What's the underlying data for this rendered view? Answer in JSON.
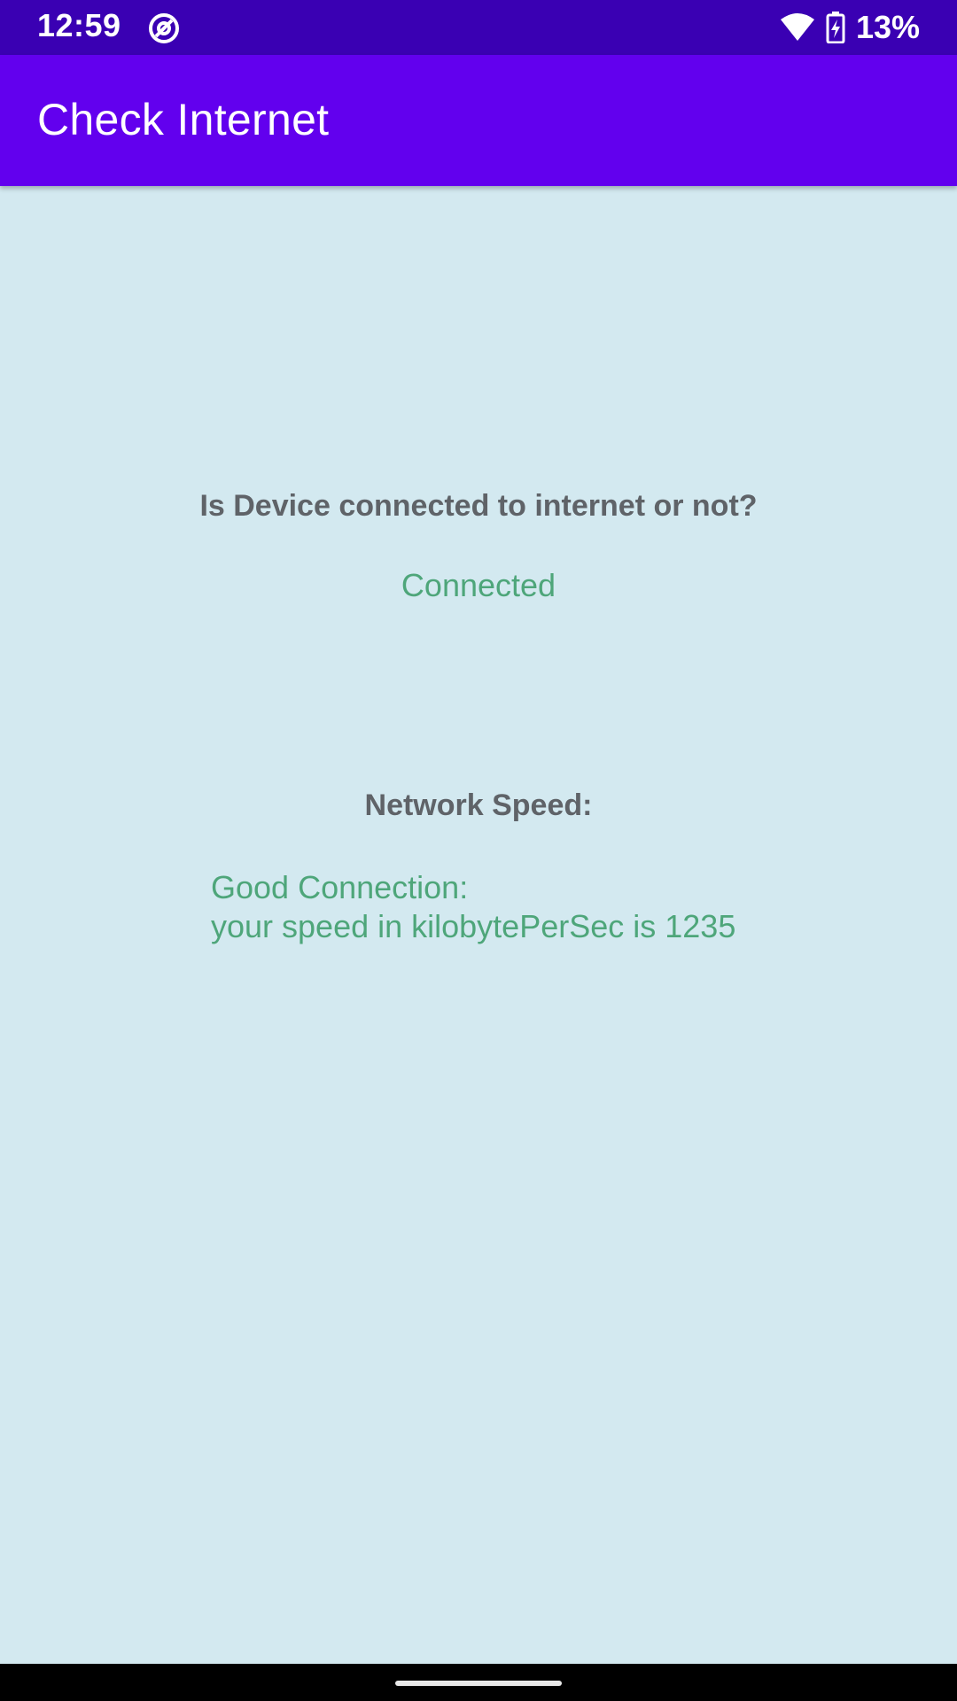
{
  "status_bar": {
    "time": "12:59",
    "notification_icon": "at-sign-icon",
    "wifi_icon": "wifi-icon",
    "battery_icon": "battery-charging-icon",
    "battery_percent": "13%"
  },
  "app_bar": {
    "title": "Check Internet",
    "color": "#6200ee"
  },
  "main": {
    "question": "Is Device connected to internet or not?",
    "connection_status": "Connected",
    "speed_heading": "Network Speed:",
    "speed_line1": "Good Connection:",
    "speed_line2": "your speed in kilobytePerSec is 1235",
    "status_color": "#4ea67a",
    "background": "#d3e9f0"
  }
}
